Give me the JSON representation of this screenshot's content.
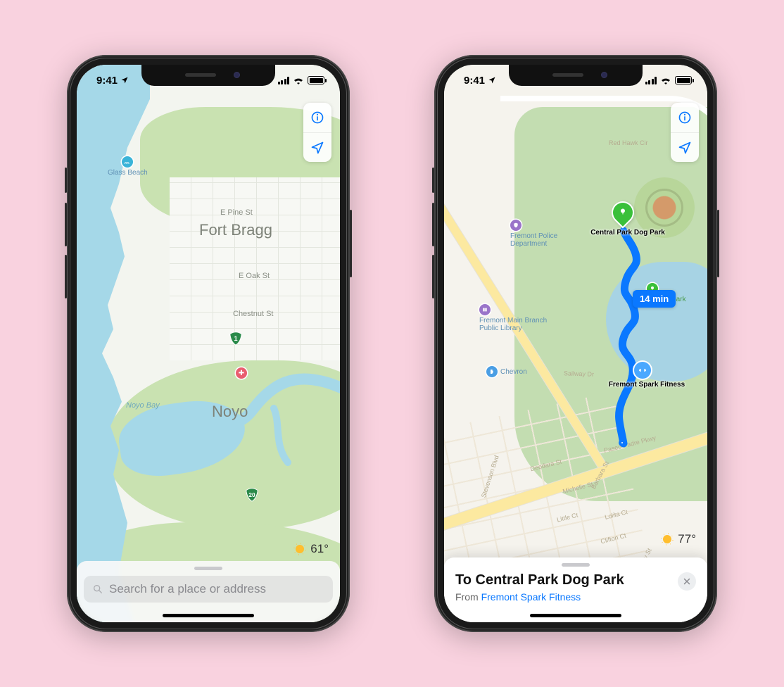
{
  "status": {
    "time": "9:41"
  },
  "controls": {
    "info_label": "Info",
    "locate_label": "Locate"
  },
  "phone1": {
    "weather": "61°",
    "search_placeholder": "Search for a place or address",
    "labels": {
      "city": "Fort Bragg",
      "noyo": "Noyo",
      "e_pine": "E Pine St",
      "e_oak": "E Oak St",
      "chestnut": "Chestnut St",
      "noyo_bay": "Noyo Bay",
      "glass_beach": "Glass Beach",
      "hwy1": "1",
      "hwy20": "20"
    }
  },
  "phone2": {
    "weather": "77°",
    "route_time": "14 min",
    "sheet": {
      "title": "To Central Park Dog Park",
      "from_prefix": "From ",
      "from_link": "Fremont Spark Fitness"
    },
    "labels": {
      "red_hawk": "Red Hawk Cir",
      "police": "Fremont Police Department",
      "dog_park": "Central Park Dog Park",
      "central_park": "Central Park",
      "library": "Fremont Main Branch Public Library",
      "chevron": "Chevron",
      "sailway": "Sailway Dr",
      "fitness": "Fremont Spark Fitness",
      "paseo": "Paseo Padre Pkwy",
      "stevenson": "Stevenson Blvd",
      "deodara": "Deodara St",
      "barbara": "Barbara St",
      "michelle": "Michelle St",
      "little": "Little Ct",
      "lolita": "Lolita Ct",
      "clifton": "Clifton Ct",
      "kelly": "Kelly St"
    }
  }
}
